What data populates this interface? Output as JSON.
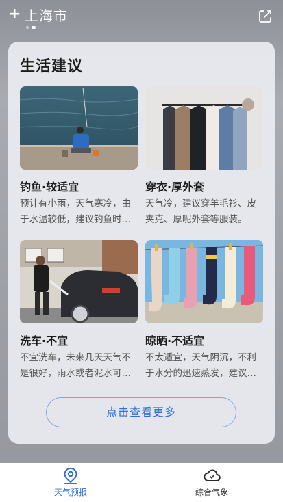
{
  "header": {
    "add_icon": "plus-icon",
    "city": "上海市",
    "edit_icon": "edit-icon",
    "page_dots": 2,
    "active_dot": 1
  },
  "card": {
    "title": "生活建议",
    "items": [
      {
        "image": "fishing-photo",
        "title": "钓鱼·较适宜",
        "desc": "预计有小雨，天气寒冷，由于水温较低，建议钓鱼时注意保暖。"
      },
      {
        "image": "clothes-rack-photo",
        "title": "穿衣·厚外套",
        "desc": "天气冷，建议穿羊毛衫、皮夹克、厚呢外套等服装。"
      },
      {
        "image": "car-wash-photo",
        "title": "洗车·不宜",
        "desc": "不宜洗车，未来几天天气不是很好，雨水或者泥水可能会弄脏您的爱车。"
      },
      {
        "image": "socks-drying-photo",
        "title": "晾晒·不适宜",
        "desc": "不太适宜，天气阴沉，不利于水分的迅速蒸发，建议在室内晾晒。"
      }
    ],
    "more_button": "点击查看更多"
  },
  "nav": {
    "items": [
      {
        "icon": "location-pin-icon",
        "label": "天气预报",
        "active": true
      },
      {
        "icon": "cloud-icon",
        "label": "综合气象",
        "active": false
      }
    ],
    "active_color": "#2f6fd6"
  }
}
